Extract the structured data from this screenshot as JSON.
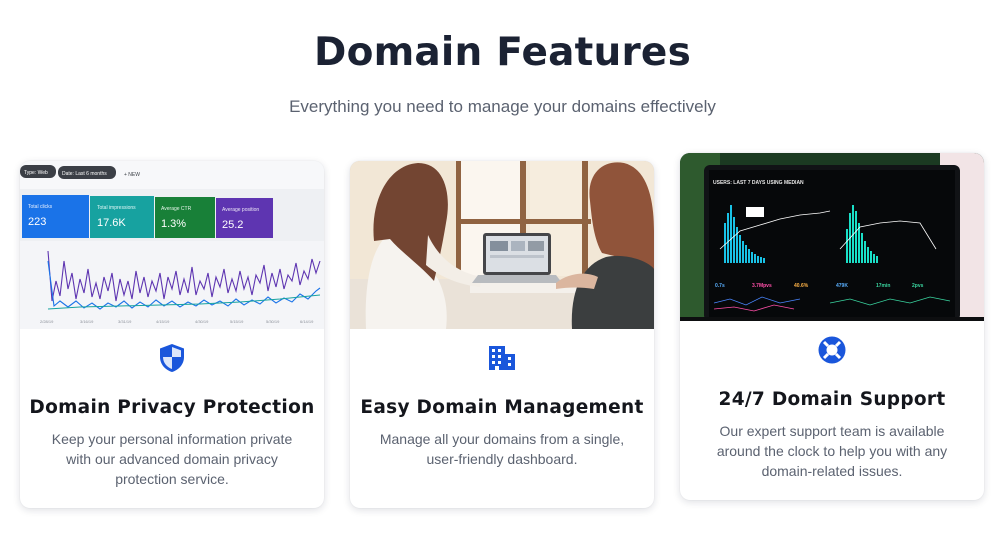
{
  "section": {
    "title": "Domain Features",
    "subtitle": "Everything you need to manage your domains effectively"
  },
  "colors": {
    "icon_accent": "#1a56db",
    "title_text": "#1b2233",
    "body_text": "#5b6270"
  },
  "cards": [
    {
      "icon": "shield-icon",
      "title": "Domain Privacy Protection",
      "description": "Keep your personal information private with our advanced domain privacy protection service.",
      "image": {
        "chips": [
          "Type: Web",
          "Date: Last 6 months",
          "+ NEW"
        ],
        "metrics": [
          {
            "label": "Total clicks",
            "value": "223",
            "color": "#1a73e8"
          },
          {
            "label": "Total impressions",
            "value": "17.6K",
            "color": "#1aa3a3"
          },
          {
            "label": "Average CTR",
            "value": "1.3%",
            "color": "#188038"
          },
          {
            "label": "Average position",
            "value": "25.2",
            "color": "#5e35b1"
          }
        ]
      }
    },
    {
      "icon": "building-icon",
      "title": "Easy Domain Management",
      "description": "Manage all your domains from a single, user-friendly dashboard."
    },
    {
      "icon": "lifebuoy-icon",
      "title": "24/7 Domain Support",
      "description": "Our expert support team is available around the clock to help you with any domain-related issues.",
      "image": {
        "header": "USERS: LAST 7 DAYS USING MEDIAN",
        "stats": [
          "0.7s",
          "3.7Mpvs",
          "40.6%",
          "479K",
          "17min",
          "2pvs"
        ]
      }
    }
  ]
}
